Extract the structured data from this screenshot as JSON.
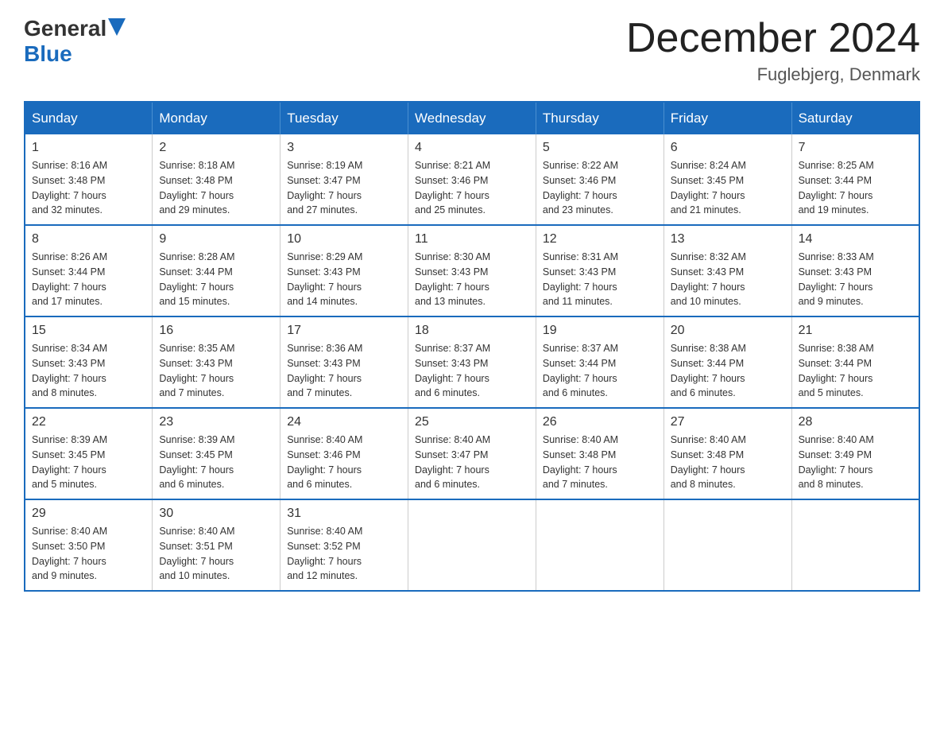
{
  "logo": {
    "general": "General",
    "blue": "Blue"
  },
  "title": "December 2024",
  "location": "Fuglebjerg, Denmark",
  "days_of_week": [
    "Sunday",
    "Monday",
    "Tuesday",
    "Wednesday",
    "Thursday",
    "Friday",
    "Saturday"
  ],
  "weeks": [
    [
      {
        "day": "1",
        "sunrise": "8:16 AM",
        "sunset": "3:48 PM",
        "daylight": "7 hours and 32 minutes."
      },
      {
        "day": "2",
        "sunrise": "8:18 AM",
        "sunset": "3:48 PM",
        "daylight": "7 hours and 29 minutes."
      },
      {
        "day": "3",
        "sunrise": "8:19 AM",
        "sunset": "3:47 PM",
        "daylight": "7 hours and 27 minutes."
      },
      {
        "day": "4",
        "sunrise": "8:21 AM",
        "sunset": "3:46 PM",
        "daylight": "7 hours and 25 minutes."
      },
      {
        "day": "5",
        "sunrise": "8:22 AM",
        "sunset": "3:46 PM",
        "daylight": "7 hours and 23 minutes."
      },
      {
        "day": "6",
        "sunrise": "8:24 AM",
        "sunset": "3:45 PM",
        "daylight": "7 hours and 21 minutes."
      },
      {
        "day": "7",
        "sunrise": "8:25 AM",
        "sunset": "3:44 PM",
        "daylight": "7 hours and 19 minutes."
      }
    ],
    [
      {
        "day": "8",
        "sunrise": "8:26 AM",
        "sunset": "3:44 PM",
        "daylight": "7 hours and 17 minutes."
      },
      {
        "day": "9",
        "sunrise": "8:28 AM",
        "sunset": "3:44 PM",
        "daylight": "7 hours and 15 minutes."
      },
      {
        "day": "10",
        "sunrise": "8:29 AM",
        "sunset": "3:43 PM",
        "daylight": "7 hours and 14 minutes."
      },
      {
        "day": "11",
        "sunrise": "8:30 AM",
        "sunset": "3:43 PM",
        "daylight": "7 hours and 13 minutes."
      },
      {
        "day": "12",
        "sunrise": "8:31 AM",
        "sunset": "3:43 PM",
        "daylight": "7 hours and 11 minutes."
      },
      {
        "day": "13",
        "sunrise": "8:32 AM",
        "sunset": "3:43 PM",
        "daylight": "7 hours and 10 minutes."
      },
      {
        "day": "14",
        "sunrise": "8:33 AM",
        "sunset": "3:43 PM",
        "daylight": "7 hours and 9 minutes."
      }
    ],
    [
      {
        "day": "15",
        "sunrise": "8:34 AM",
        "sunset": "3:43 PM",
        "daylight": "7 hours and 8 minutes."
      },
      {
        "day": "16",
        "sunrise": "8:35 AM",
        "sunset": "3:43 PM",
        "daylight": "7 hours and 7 minutes."
      },
      {
        "day": "17",
        "sunrise": "8:36 AM",
        "sunset": "3:43 PM",
        "daylight": "7 hours and 7 minutes."
      },
      {
        "day": "18",
        "sunrise": "8:37 AM",
        "sunset": "3:43 PM",
        "daylight": "7 hours and 6 minutes."
      },
      {
        "day": "19",
        "sunrise": "8:37 AM",
        "sunset": "3:44 PM",
        "daylight": "7 hours and 6 minutes."
      },
      {
        "day": "20",
        "sunrise": "8:38 AM",
        "sunset": "3:44 PM",
        "daylight": "7 hours and 6 minutes."
      },
      {
        "day": "21",
        "sunrise": "8:38 AM",
        "sunset": "3:44 PM",
        "daylight": "7 hours and 5 minutes."
      }
    ],
    [
      {
        "day": "22",
        "sunrise": "8:39 AM",
        "sunset": "3:45 PM",
        "daylight": "7 hours and 5 minutes."
      },
      {
        "day": "23",
        "sunrise": "8:39 AM",
        "sunset": "3:45 PM",
        "daylight": "7 hours and 6 minutes."
      },
      {
        "day": "24",
        "sunrise": "8:40 AM",
        "sunset": "3:46 PM",
        "daylight": "7 hours and 6 minutes."
      },
      {
        "day": "25",
        "sunrise": "8:40 AM",
        "sunset": "3:47 PM",
        "daylight": "7 hours and 6 minutes."
      },
      {
        "day": "26",
        "sunrise": "8:40 AM",
        "sunset": "3:48 PM",
        "daylight": "7 hours and 7 minutes."
      },
      {
        "day": "27",
        "sunrise": "8:40 AM",
        "sunset": "3:48 PM",
        "daylight": "7 hours and 8 minutes."
      },
      {
        "day": "28",
        "sunrise": "8:40 AM",
        "sunset": "3:49 PM",
        "daylight": "7 hours and 8 minutes."
      }
    ],
    [
      {
        "day": "29",
        "sunrise": "8:40 AM",
        "sunset": "3:50 PM",
        "daylight": "7 hours and 9 minutes."
      },
      {
        "day": "30",
        "sunrise": "8:40 AM",
        "sunset": "3:51 PM",
        "daylight": "7 hours and 10 minutes."
      },
      {
        "day": "31",
        "sunrise": "8:40 AM",
        "sunset": "3:52 PM",
        "daylight": "7 hours and 12 minutes."
      },
      null,
      null,
      null,
      null
    ]
  ],
  "labels": {
    "sunrise": "Sunrise:",
    "sunset": "Sunset:",
    "daylight": "Daylight:"
  }
}
